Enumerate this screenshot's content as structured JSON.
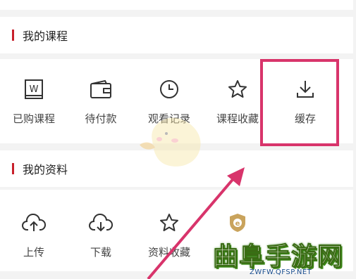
{
  "sections": [
    {
      "title": "我的课程",
      "items": [
        {
          "label": "已购课程",
          "icon": "purchased-courses-icon"
        },
        {
          "label": "待付款",
          "icon": "wallet-icon"
        },
        {
          "label": "观看记录",
          "icon": "clock-icon"
        },
        {
          "label": "课程收藏",
          "icon": "star-icon"
        },
        {
          "label": "缓存",
          "icon": "download-icon"
        }
      ]
    },
    {
      "title": "我的资料",
      "items": [
        {
          "label": "上传",
          "icon": "cloud-upload-icon"
        },
        {
          "label": "下载",
          "icon": "cloud-download-icon"
        },
        {
          "label": "资料收藏",
          "icon": "star-icon"
        },
        {
          "label": "",
          "icon": "shield-e-icon"
        }
      ]
    }
  ],
  "watermark": {
    "title": "曲阜手游网",
    "url": "ZWFW.QFSP.NET"
  },
  "colors": {
    "accent": "#c8202b",
    "highlight": "#d8346b",
    "arrow": "#d8346b"
  }
}
